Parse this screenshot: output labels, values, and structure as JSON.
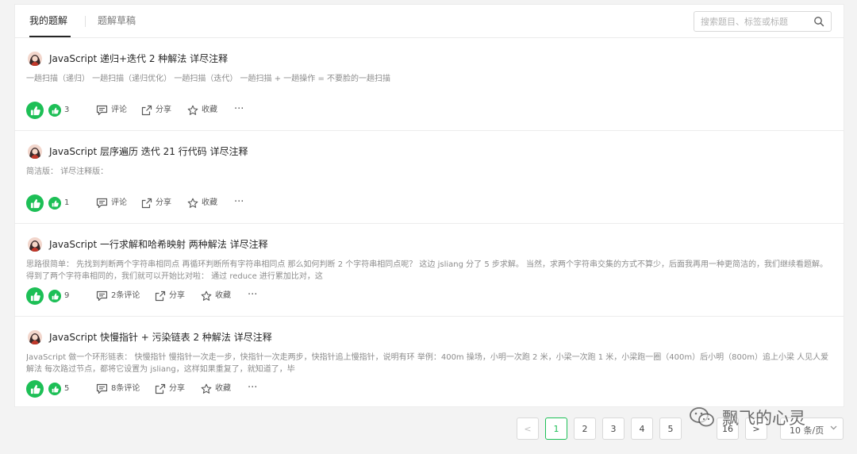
{
  "tabs": {
    "my_solutions": "我的题解",
    "drafts": "题解草稿"
  },
  "search": {
    "placeholder": "搜索题目、标签或标题"
  },
  "posts": [
    {
      "title": "JavaScript 递归+迭代 2 种解法 详尽注释",
      "summary": "一趟扫描（递归） 一趟扫描（递归优化） 一趟扫描（迭代） 一趟扫描 + 一趟操作 = 不要脸的一趟扫描",
      "likes": "3",
      "comments": "评论",
      "share": "分享",
      "favorite": "收藏",
      "more": "···"
    },
    {
      "title": "JavaScript 层序遍历 迭代 21 行代码 详尽注释",
      "summary": "简洁版： 详尽注释版：",
      "likes": "1",
      "comments": "评论",
      "share": "分享",
      "favorite": "收藏",
      "more": "···"
    },
    {
      "title": "JavaScript 一行求解和哈希映射 两种解法 详尽注释",
      "summary": "思路很简单： 先找到判断两个字符串相同点 再循环判断所有字符串相同点 那么如何判断 2 个字符串相同点呢？ 这边 jsliang 分了 5 步求解。 当然，求两个字符串交集的方式不算少，后面我再用一种更简洁的，我们继续看题解。 得到了两个字符串相同的，我们就可以开始比对啦： 通过 reduce 进行累加比对，这",
      "likes": "9",
      "comments": "2条评论",
      "share": "分享",
      "favorite": "收藏",
      "more": "···"
    },
    {
      "title": "JavaScript 快慢指针 + 污染链表 2 种解法 详尽注释",
      "summary": "JavaScript 做一个环形链表： 快慢指针 慢指针一次走一步，快指针一次走两步，快指针追上慢指针，说明有环 举例：400m 操场，小明一次跑 2 米，小梁一次跑 1 米，小梁跑一圈（400m）后小明（800m）追上小梁 人见人爱解法 每次路过节点，都将它设置为 jsliang，这样如果重复了，就知道了，毕",
      "likes": "5",
      "comments": "8条评论",
      "share": "分享",
      "favorite": "收藏",
      "more": "···"
    }
  ],
  "pagination": {
    "prev": "<",
    "pages": [
      "1",
      "2",
      "3",
      "4",
      "5"
    ],
    "last": "16",
    "next": ">",
    "current": "1",
    "page_size": "10 条/页"
  },
  "watermark": {
    "text": "飘飞的心灵"
  },
  "colors": {
    "accent": "#1dbf56",
    "text": "#262626",
    "muted": "#8c8c8c"
  }
}
